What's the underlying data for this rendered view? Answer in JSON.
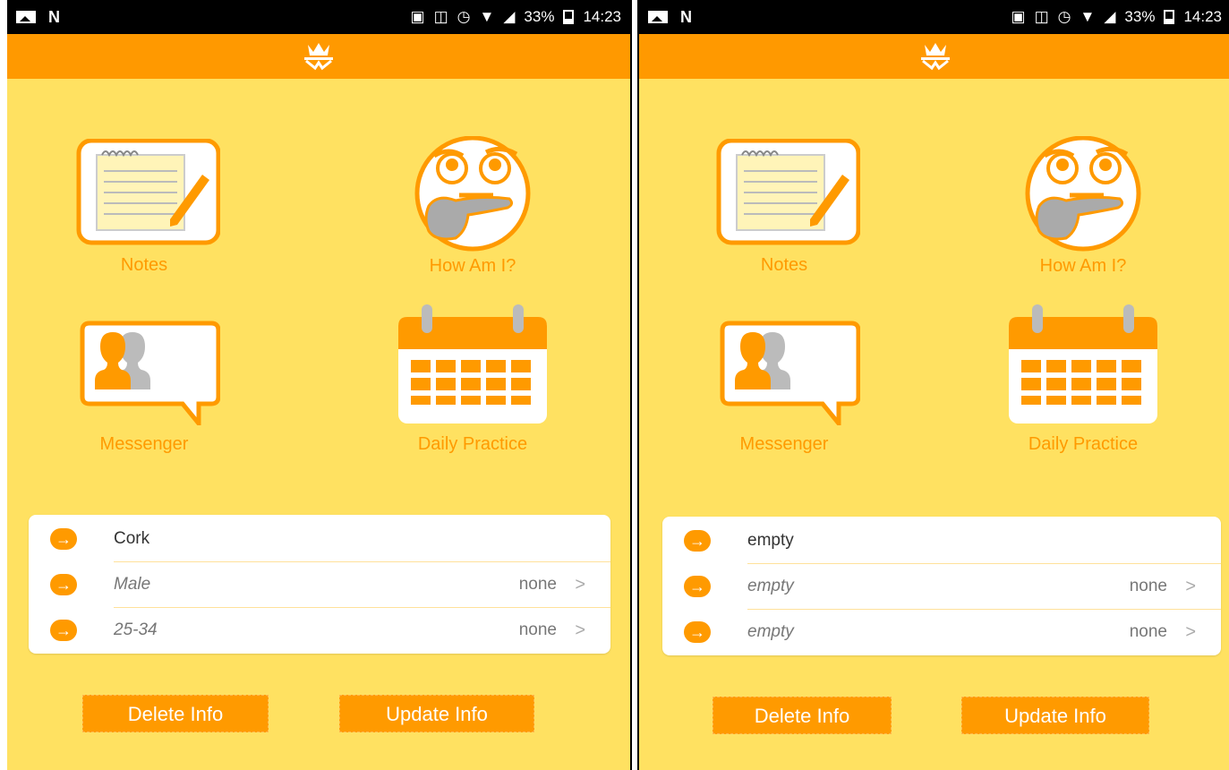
{
  "screens": [
    {
      "status": {
        "battery": "33%",
        "time": "14:23"
      },
      "tiles": {
        "notes": "Notes",
        "how_am_i": "How Am I?",
        "messenger": "Messenger",
        "daily_practice": "Daily Practice"
      },
      "info_rows": [
        {
          "text": "Cork",
          "value": "",
          "italic": false
        },
        {
          "text": "Male",
          "value": "none",
          "italic": true
        },
        {
          "text": "25-34",
          "value": "none",
          "italic": true
        }
      ],
      "buttons": {
        "delete": "Delete Info",
        "update": "Update Info"
      }
    },
    {
      "status": {
        "battery": "33%",
        "time": "14:23"
      },
      "tiles": {
        "notes": "Notes",
        "how_am_i": "How Am I?",
        "messenger": "Messenger",
        "daily_practice": "Daily Practice"
      },
      "info_rows": [
        {
          "text": "empty",
          "value": "",
          "italic": false
        },
        {
          "text": "empty",
          "value": "none",
          "italic": true
        },
        {
          "text": "empty",
          "value": "none",
          "italic": true
        }
      ],
      "buttons": {
        "delete": "Delete Info",
        "update": "Update Info"
      }
    }
  ],
  "colors": {
    "accent": "#ff9a00",
    "background": "#ffe161",
    "app_bar": "#ff9900"
  },
  "icons": {
    "status_left": [
      "gallery-icon",
      "nfc-n-icon"
    ],
    "status_right": [
      "nfc-icon",
      "vibrate-icon",
      "alarm-icon",
      "wifi-icon",
      "signal-icon",
      "battery-icon"
    ],
    "app_logo": "lotus-logo-icon",
    "tiles": [
      "notepad-icon",
      "thinking-face-icon",
      "chat-people-icon",
      "calendar-icon"
    ],
    "row": "arrow-right-circle-icon",
    "chevron": "chevron-right-icon"
  }
}
